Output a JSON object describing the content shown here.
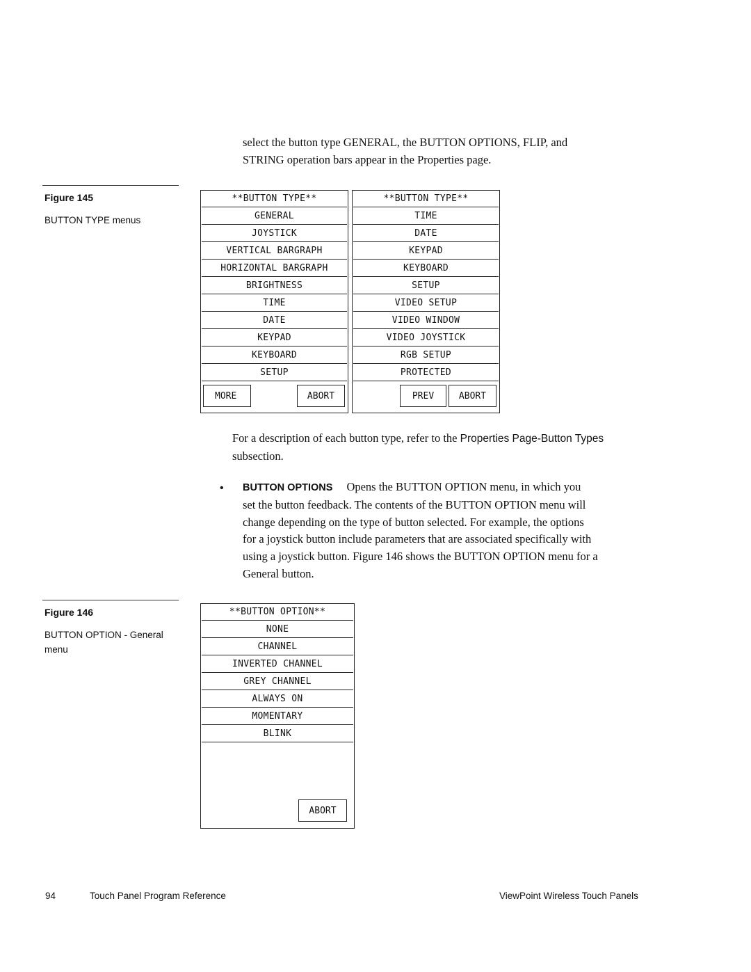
{
  "intro_paragraph": "select the button type GENERAL, the BUTTON OPTIONS, FLIP, and STRING operation bars appear in the Properties page.",
  "intro_lines": [
    "select the button type GENERAL, the BUTTON OPTIONS, FLIP, and",
    "STRING operation bars appear in the Properties page."
  ],
  "figure145": {
    "title": "Figure 145",
    "caption": "BUTTON TYPE menus",
    "menu_left": {
      "header": "**BUTTON TYPE**",
      "items": [
        "GENERAL",
        "JOYSTICK",
        "VERTICAL BARGRAPH",
        "HORIZONTAL BARGRAPH",
        "BRIGHTNESS",
        "TIME",
        "DATE",
        "KEYPAD",
        "KEYBOARD",
        "SETUP"
      ],
      "more_label": "MORE",
      "abort_label": "ABORT"
    },
    "menu_right": {
      "header": "**BUTTON TYPE**",
      "items": [
        "TIME",
        "DATE",
        "KEYPAD",
        "KEYBOARD",
        "SETUP",
        "VIDEO SETUP",
        "VIDEO WINDOW",
        "VIDEO JOYSTICK",
        "RGB SETUP",
        "PROTECTED"
      ],
      "prev_label": "PREV",
      "abort_label": "ABORT"
    }
  },
  "description_paragraph": {
    "line1_serif": "For a description of each button type, refer to the ",
    "line1_sans": "Properties Page-Button Types",
    "line2": "subsection."
  },
  "bullet_item": {
    "bullet": "•",
    "term": "BUTTON OPTIONS",
    "lines": [
      "Opens the BUTTON OPTION menu, in which you",
      "set the button feedback. The contents of the BUTTON OPTION menu will",
      "change depending on the type of button selected. For example, the options",
      "for a joystick button include parameters that are associated specifically with",
      "using a joystick button. Figure 146 shows the BUTTON OPTION menu for a",
      "General button."
    ]
  },
  "figure146": {
    "title": "Figure 146",
    "caption": "BUTTON OPTION - General menu",
    "menu": {
      "header": "**BUTTON OPTION**",
      "items": [
        "NONE",
        "CHANNEL",
        "INVERTED CHANNEL",
        "GREY CHANNEL",
        "ALWAYS ON",
        "MOMENTARY",
        "BLINK"
      ],
      "abort_label": "ABORT"
    }
  },
  "footer": {
    "page_number": "94",
    "left_title": "Touch Panel Program Reference",
    "right_title": "ViewPoint Wireless Touch Panels"
  }
}
